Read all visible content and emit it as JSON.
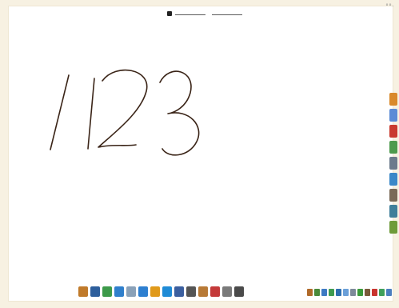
{
  "header": {
    "corner_text": "°°·"
  },
  "canvas": {
    "handwriting": "/123"
  },
  "side_dock": {
    "icons": [
      {
        "name": "folder-icon",
        "color": "#d9892b"
      },
      {
        "name": "network-icon",
        "color": "#5b8bd6"
      },
      {
        "name": "power-icon",
        "color": "#c93a2f"
      },
      {
        "name": "plugin-icon",
        "color": "#4d9a4d"
      },
      {
        "name": "photo-icon",
        "color": "#6c7b8c"
      },
      {
        "name": "globe-icon",
        "color": "#3b88c8"
      },
      {
        "name": "person-icon",
        "color": "#7a6a58"
      },
      {
        "name": "tools-icon",
        "color": "#3f7f9a"
      },
      {
        "name": "package-icon",
        "color": "#6e9b3a"
      }
    ]
  },
  "bottom_dock": {
    "icons": [
      {
        "name": "paint-icon",
        "color": "#c07a2a"
      },
      {
        "name": "monitor-icon",
        "color": "#2d5e9c"
      },
      {
        "name": "refresh-icon",
        "color": "#3d9a4a"
      },
      {
        "name": "globe-icon",
        "color": "#2f7fcc"
      },
      {
        "name": "photos-icon",
        "color": "#8aa1b8"
      },
      {
        "name": "chat-icon",
        "color": "#2d7fd0"
      },
      {
        "name": "clipboard-icon",
        "color": "#e09a1b"
      },
      {
        "name": "calendar-icon",
        "color": "#1f8bd6"
      },
      {
        "name": "window-icon",
        "color": "#3b5f9f"
      },
      {
        "name": "pen-icon",
        "color": "#555555"
      },
      {
        "name": "brush-icon",
        "color": "#b87a36"
      },
      {
        "name": "pencil-icon",
        "color": "#c43a3a"
      },
      {
        "name": "notes-icon",
        "color": "#7a7a7a"
      },
      {
        "name": "bottle-icon",
        "color": "#4a4a4a"
      }
    ]
  },
  "system_tray": {
    "icons": [
      {
        "name": "audio-icon",
        "color": "#b06a2a"
      },
      {
        "name": "plug-icon",
        "color": "#4a8a3a"
      },
      {
        "name": "network-icon",
        "color": "#3d7ac3"
      },
      {
        "name": "shield-icon",
        "color": "#3f9b4f"
      },
      {
        "name": "vnc-icon",
        "color": "#2e6fb0"
      },
      {
        "name": "chat-icon",
        "color": "#6a9fd8"
      },
      {
        "name": "clock-icon",
        "color": "#7d8a99"
      },
      {
        "name": "battery-icon",
        "color": "#3a9a3a"
      },
      {
        "name": "volume-icon",
        "color": "#7a5a3a"
      },
      {
        "name": "flag-icon",
        "color": "#c9342e"
      },
      {
        "name": "update-icon",
        "color": "#3fa05a"
      },
      {
        "name": "display-icon",
        "color": "#4b7fbf"
      }
    ]
  }
}
